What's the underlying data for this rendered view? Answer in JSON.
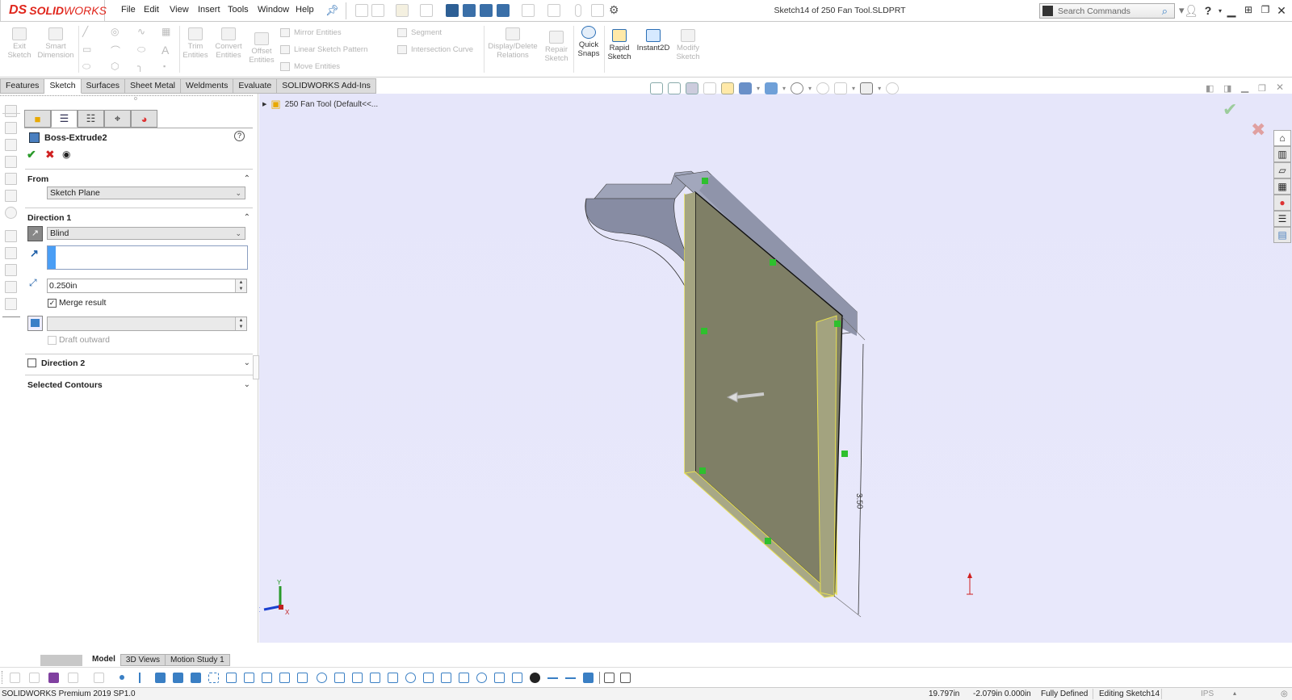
{
  "app": {
    "logo_prefix": "DS",
    "logo_bold": "SOLID",
    "logo_rest": "WORKS",
    "document_title": "Sketch14 of 250 Fan Tool.SLDPRT",
    "menu": [
      "File",
      "Edit",
      "View",
      "Insert",
      "Tools",
      "Window",
      "Help"
    ],
    "search_placeholder": "Search Commands"
  },
  "command_manager": {
    "large_buttons": [
      {
        "label": "Exit\nSketch",
        "enabled": false
      },
      {
        "label": "Smart\nDimension",
        "enabled": false
      },
      {
        "label": "Trim\nEntities",
        "enabled": false
      },
      {
        "label": "Convert\nEntities",
        "enabled": false
      },
      {
        "label": "Offset\nEntities",
        "enabled": false
      },
      {
        "label": "Display/Delete\nRelations",
        "enabled": false
      },
      {
        "label": "Repair\nSketch",
        "enabled": false
      },
      {
        "label": "Quick\nSnaps",
        "enabled": true
      },
      {
        "label": "Rapid\nSketch",
        "enabled": true
      },
      {
        "label": "Instant2D",
        "enabled": true
      },
      {
        "label": "Modify\nSketch",
        "enabled": false
      }
    ],
    "row_buttons": [
      "Mirror Entities",
      "Linear Sketch Pattern",
      "Move Entities",
      "Segment",
      "Intersection Curve"
    ],
    "tabs": [
      "Features",
      "Sketch",
      "Surfaces",
      "Sheet Metal",
      "Weldments",
      "Evaluate",
      "SOLIDWORKS Add-Ins"
    ],
    "active_tab": "Sketch"
  },
  "property_manager": {
    "title": "Boss-Extrude2",
    "tabs": [
      "feature-manager-icon",
      "property-manager-icon",
      "configuration-manager-icon",
      "dimxpert-icon",
      "display-manager-icon"
    ],
    "from": {
      "label": "From",
      "value": "Sketch Plane"
    },
    "direction1": {
      "label": "Direction 1",
      "end_condition": "Blind",
      "direction_selection": "",
      "depth": "0.250in",
      "merge_result_label": "Merge result",
      "merge_result": true,
      "draft_value": "",
      "draft_outward_label": "Draft outward",
      "draft_outward": false
    },
    "direction2": {
      "label": "Direction 2",
      "checked": false
    },
    "selected_contours": {
      "label": "Selected Contours"
    }
  },
  "viewport": {
    "tree_root": "250 Fan Tool  (Default<<...",
    "dimension_value": "3.50",
    "triad_labels": {
      "x": "X",
      "y": "Y",
      "z": "Z"
    }
  },
  "bottom_tabs": [
    "Model",
    "3D Views",
    "Motion Study 1"
  ],
  "active_bottom_tab": "Model",
  "status_bar": {
    "product": "SOLIDWORKS Premium 2019 SP1.0",
    "x_coord": "19.797in",
    "yz_coord": "-2.079in 0.000in",
    "sketch_state": "Fully Defined",
    "editing": "Editing Sketch14",
    "units": "IPS"
  }
}
